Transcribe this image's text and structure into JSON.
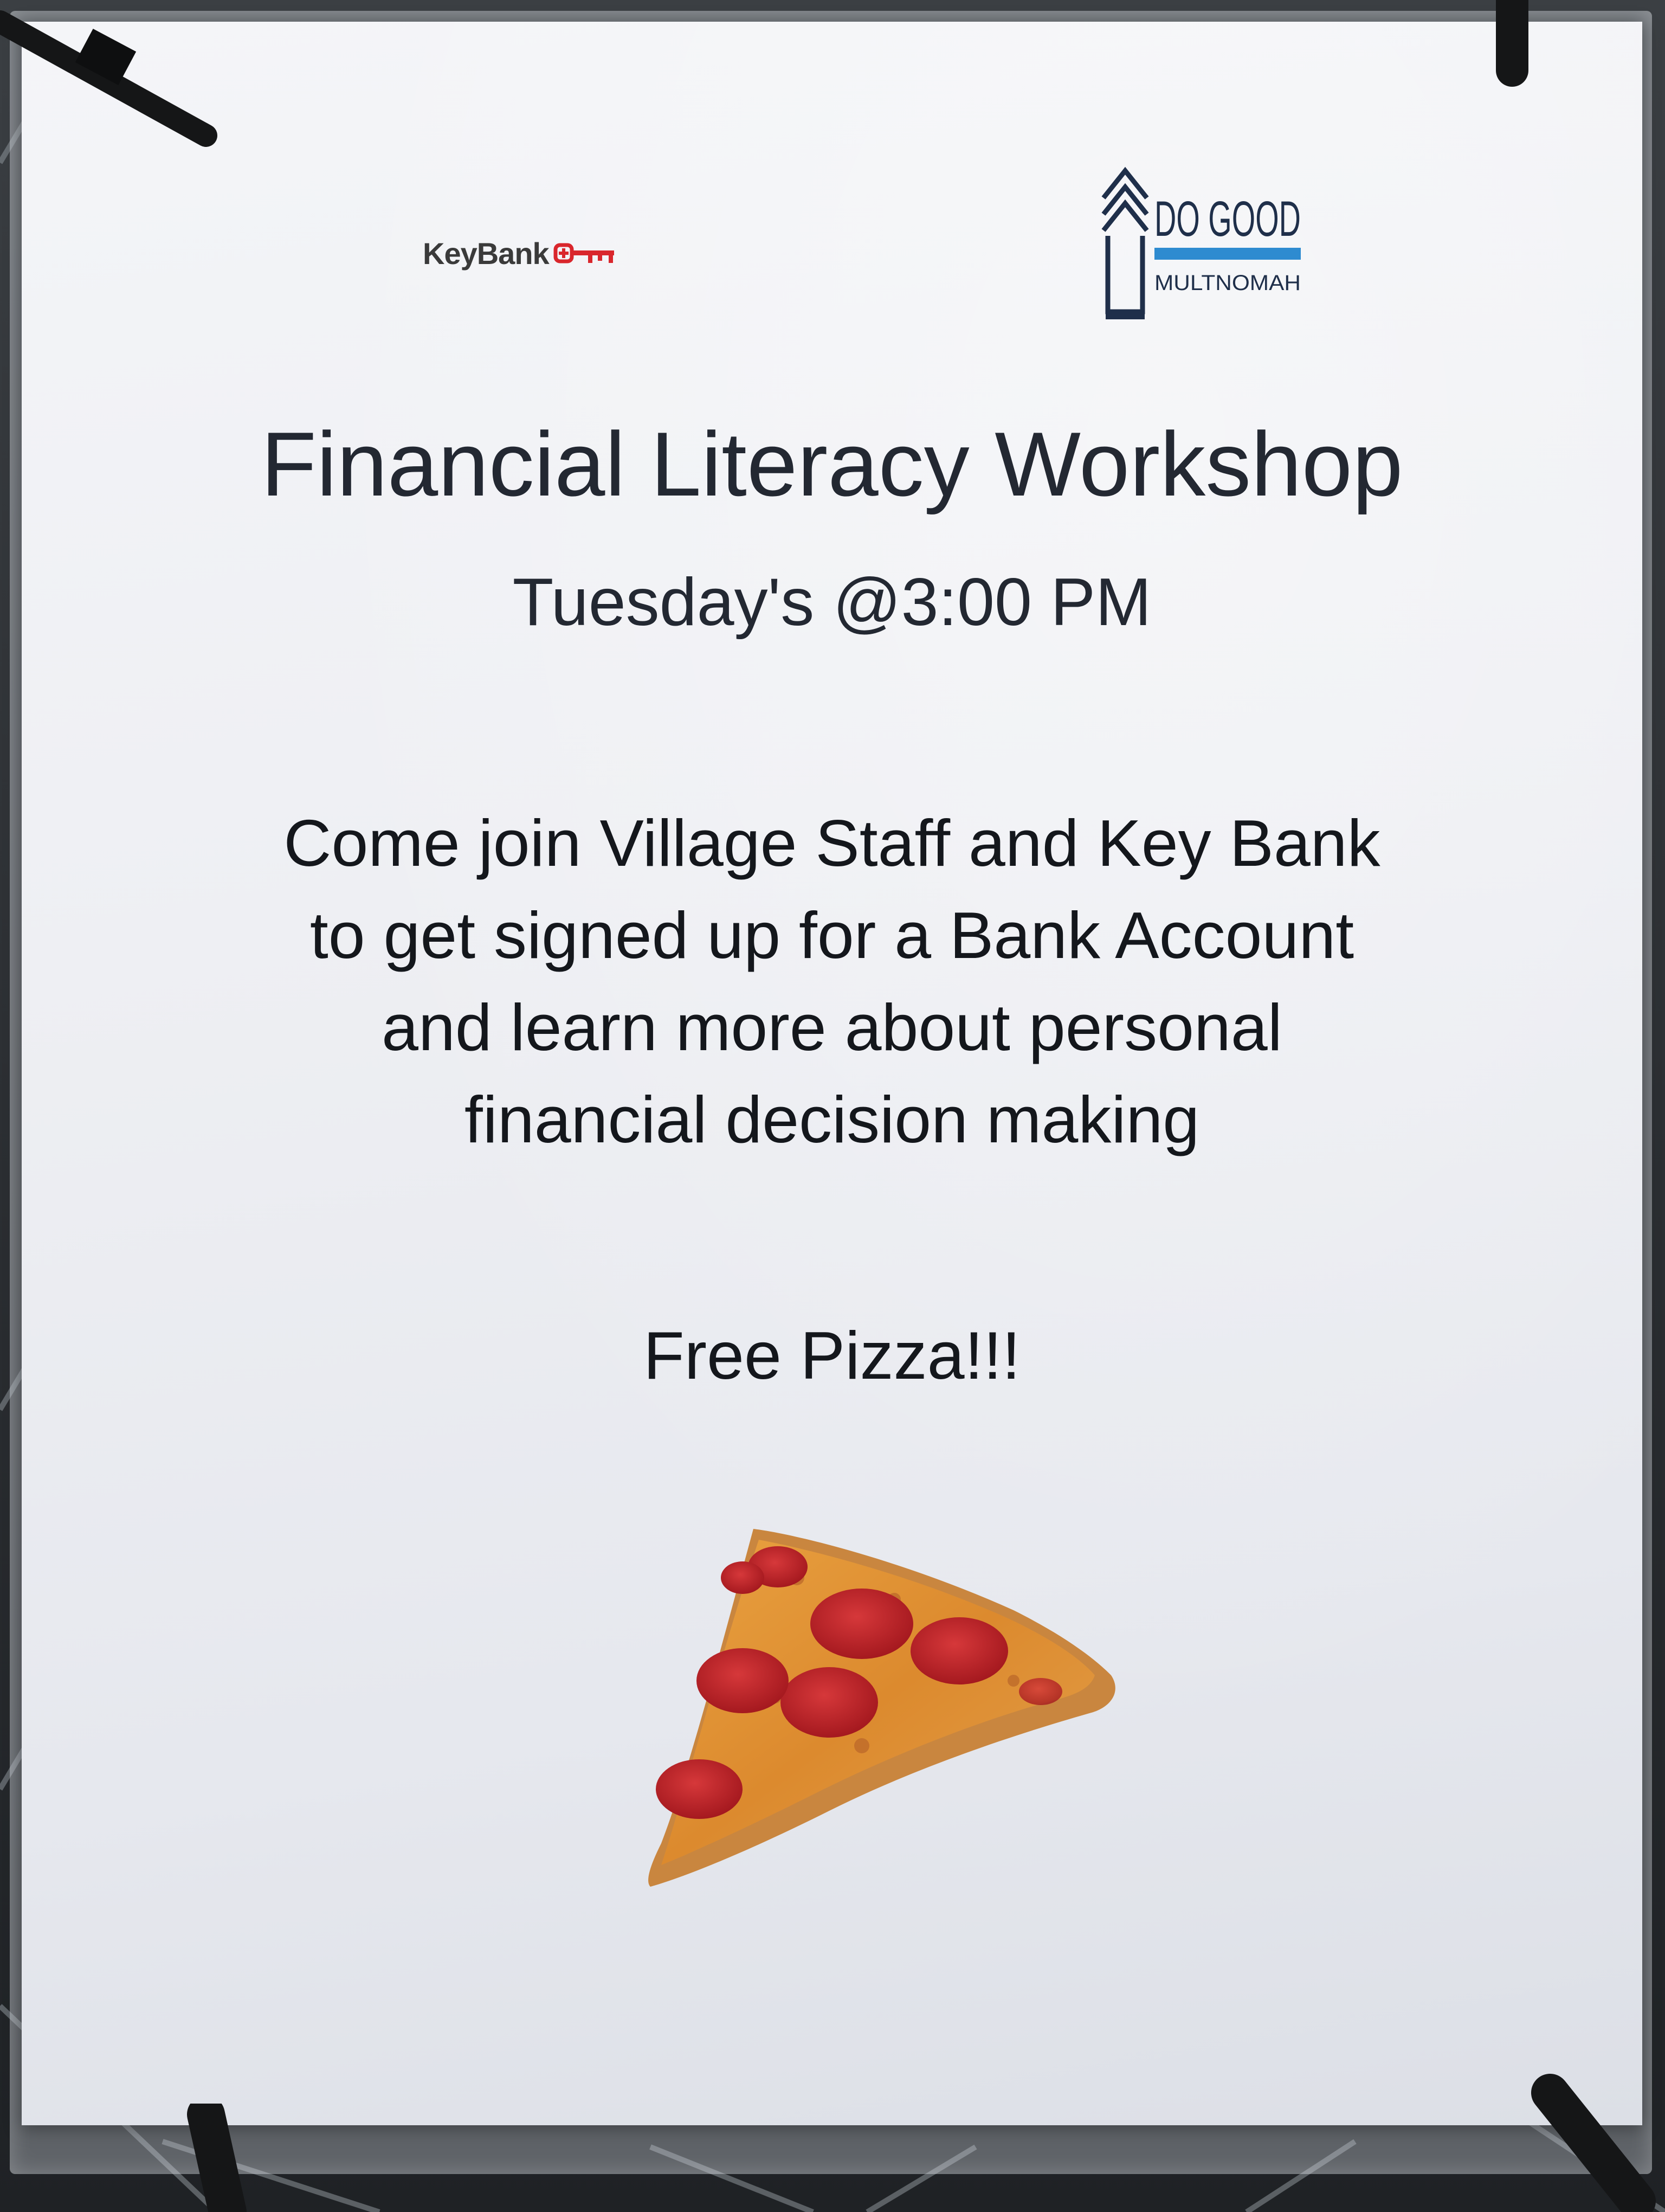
{
  "logos": {
    "keybank": "KeyBank",
    "dogood_line1": "DO GOOD",
    "dogood_line2": "MULTNOMAH"
  },
  "sign": {
    "title": "Financial Literacy Workshop",
    "schedule": "Tuesday's @3:00 PM",
    "body_lines": [
      "Come join Village Staff and Key Bank",
      "to get signed up for a Bank Account",
      "and learn more about personal",
      "financial decision making"
    ],
    "free_food": "Free Pizza!!!"
  },
  "colors": {
    "keybank_red": "#d9262c",
    "dogood_navy": "#1f2f4a",
    "dogood_blue": "#2e8bd0",
    "text": "#1c1f26"
  },
  "icons": {
    "keybank": "key-icon",
    "dogood": "house-chevron-icon",
    "food": "pizza-slice-icon"
  }
}
